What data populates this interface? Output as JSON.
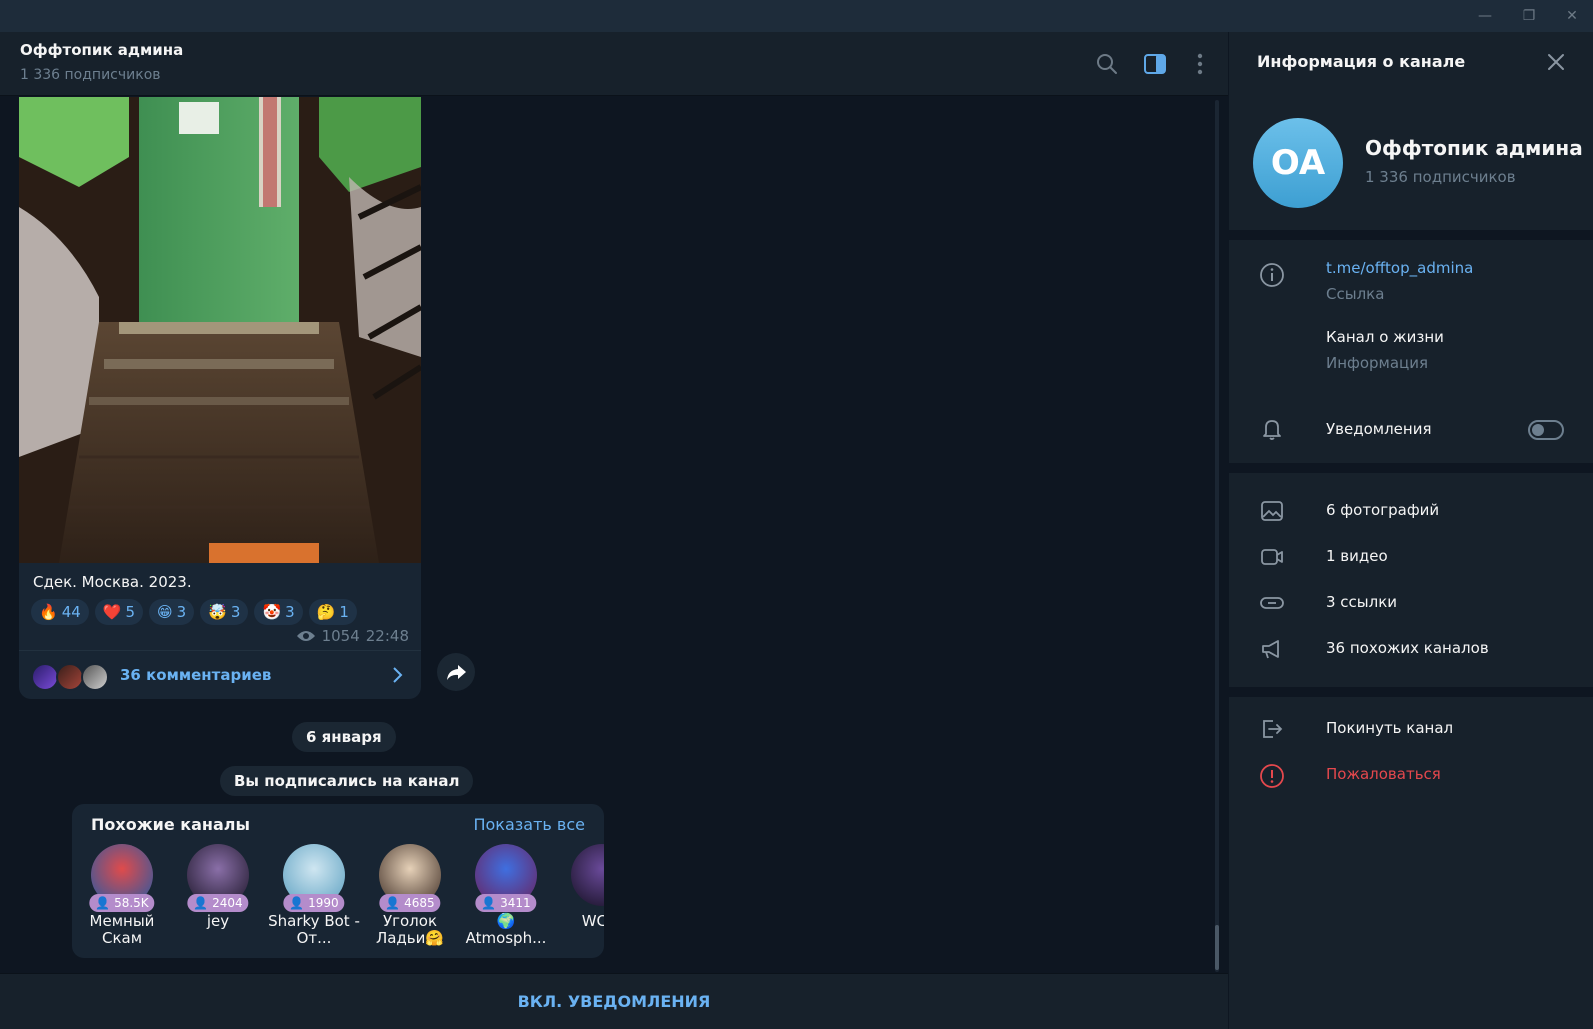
{
  "window": {
    "minimize_glyph": "—",
    "maximize_glyph": "❐",
    "close_glyph": "✕"
  },
  "chat_header": {
    "title": "Оффтопик админа",
    "subtitle": "1 336 подписчиков"
  },
  "post": {
    "caption": "Сдек. Москва. 2023.",
    "reactions": [
      {
        "icon": "fire-emoji",
        "emoji": "🔥",
        "count": "44"
      },
      {
        "icon": "heart-emoji",
        "emoji": "❤️",
        "count": "5"
      },
      {
        "icon": "grin-emoji",
        "emoji": "😁",
        "count": "3"
      },
      {
        "icon": "exploding-head-emoji",
        "emoji": "🤯",
        "count": "3"
      },
      {
        "icon": "clown-emoji",
        "emoji": "🤡",
        "count": "3"
      },
      {
        "icon": "thinking-emoji",
        "emoji": "🤔",
        "count": "1"
      }
    ],
    "views": "1054",
    "time": "22:48",
    "comments_label": "36 комментариев"
  },
  "service": {
    "date": "6 января",
    "joined": "Вы подписались на канал"
  },
  "similar": {
    "title": "Похожие каналы",
    "show_all": "Показать все",
    "channels": [
      {
        "badge": "58.5K",
        "name": "Мемный Скам"
      },
      {
        "badge": "2404",
        "name": "jey"
      },
      {
        "badge": "1990",
        "name": "Sharky Bot - От..."
      },
      {
        "badge": "4685",
        "name": "Уголок Ладьи🤗"
      },
      {
        "badge": "3411",
        "name": "🌍 Atmosph..."
      },
      {
        "badge": "",
        "name": "WC C"
      }
    ]
  },
  "bottom": {
    "notify_label": "ВКЛ. УВЕДОМЛЕНИЯ"
  },
  "panel": {
    "title": "Информация о канале",
    "avatar_initials": "OA",
    "name": "Оффтопик админа",
    "subscribers": "1 336 подписчиков",
    "link": "t.me/offtop_admina",
    "link_hint": "Ссылка",
    "about": "Канал о жизни",
    "about_hint": "Информация",
    "notifications": "Уведомления",
    "notifications_on": false,
    "media": {
      "photos": "6 фотографий",
      "videos": "1 видео",
      "links": "3 ссылки",
      "similar": "36 похожих каналов"
    },
    "leave": "Покинуть канал",
    "report": "Пожаловаться"
  },
  "colors": {
    "accent": "#6ab2f2",
    "danger": "#e5484d",
    "background": "#0e1621",
    "surface": "#17212b",
    "bubble": "#182533"
  }
}
